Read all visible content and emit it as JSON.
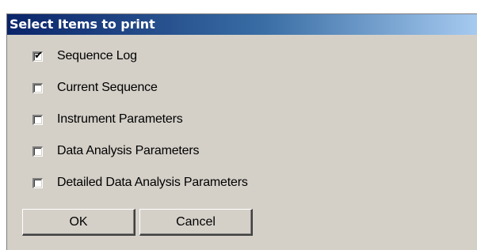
{
  "dialog": {
    "title": "Select Items to print"
  },
  "options": [
    {
      "label": "Sequence Log",
      "checked": true
    },
    {
      "label": "Current Sequence",
      "checked": false
    },
    {
      "label": "Instrument Parameters",
      "checked": false
    },
    {
      "label": "Data Analysis Parameters",
      "checked": false
    },
    {
      "label": "Detailed Data Analysis Parameters",
      "checked": false
    }
  ],
  "buttons": {
    "ok_label": "OK",
    "cancel_label": "Cancel"
  },
  "icons": {
    "checkmark": "checkmark-icon"
  }
}
